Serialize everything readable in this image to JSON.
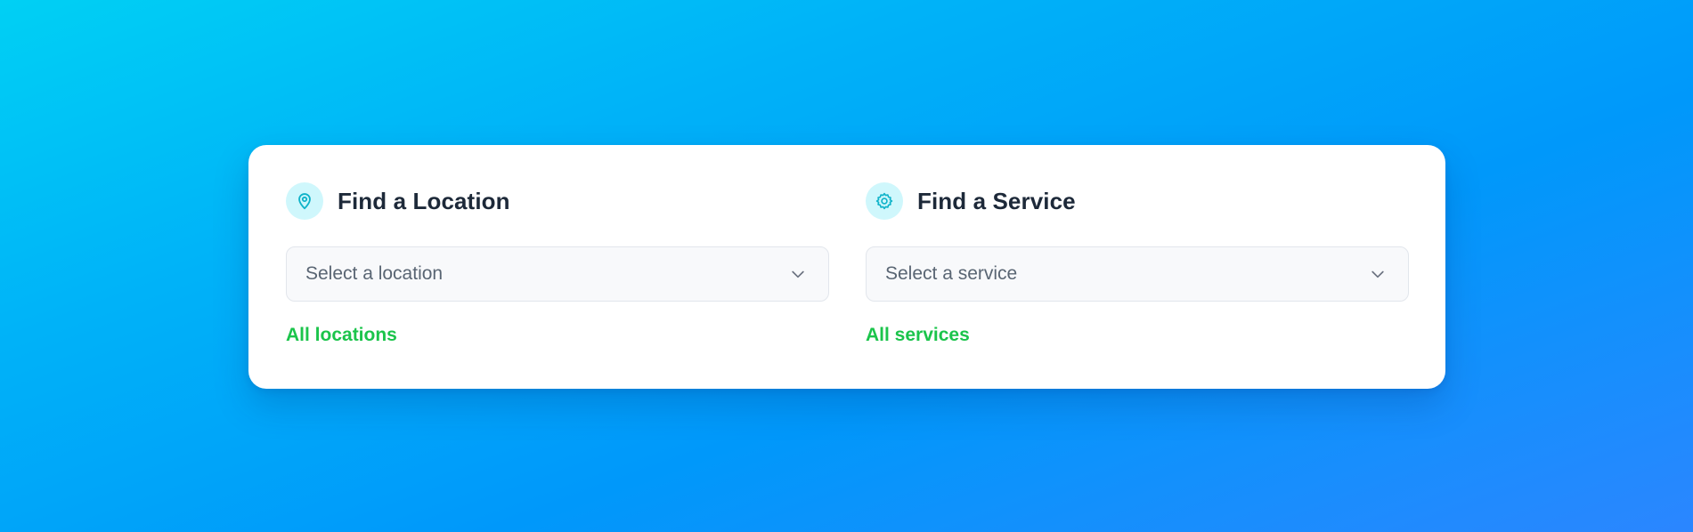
{
  "location_panel": {
    "icon": "map-pin-icon",
    "title": "Find a Location",
    "select_value": "Select a location",
    "link_label": "All locations"
  },
  "service_panel": {
    "icon": "gear-icon",
    "title": "Find a Service",
    "select_value": "Select a service",
    "link_label": "All services"
  },
  "colors": {
    "background_gradient": [
      "#00d0f4",
      "#0098fa",
      "#2b86ff"
    ],
    "icon_accent": "#0fb3c9",
    "icon_bg": "#cff7fc",
    "title": "#1d2939",
    "link": "#1bc44b"
  }
}
